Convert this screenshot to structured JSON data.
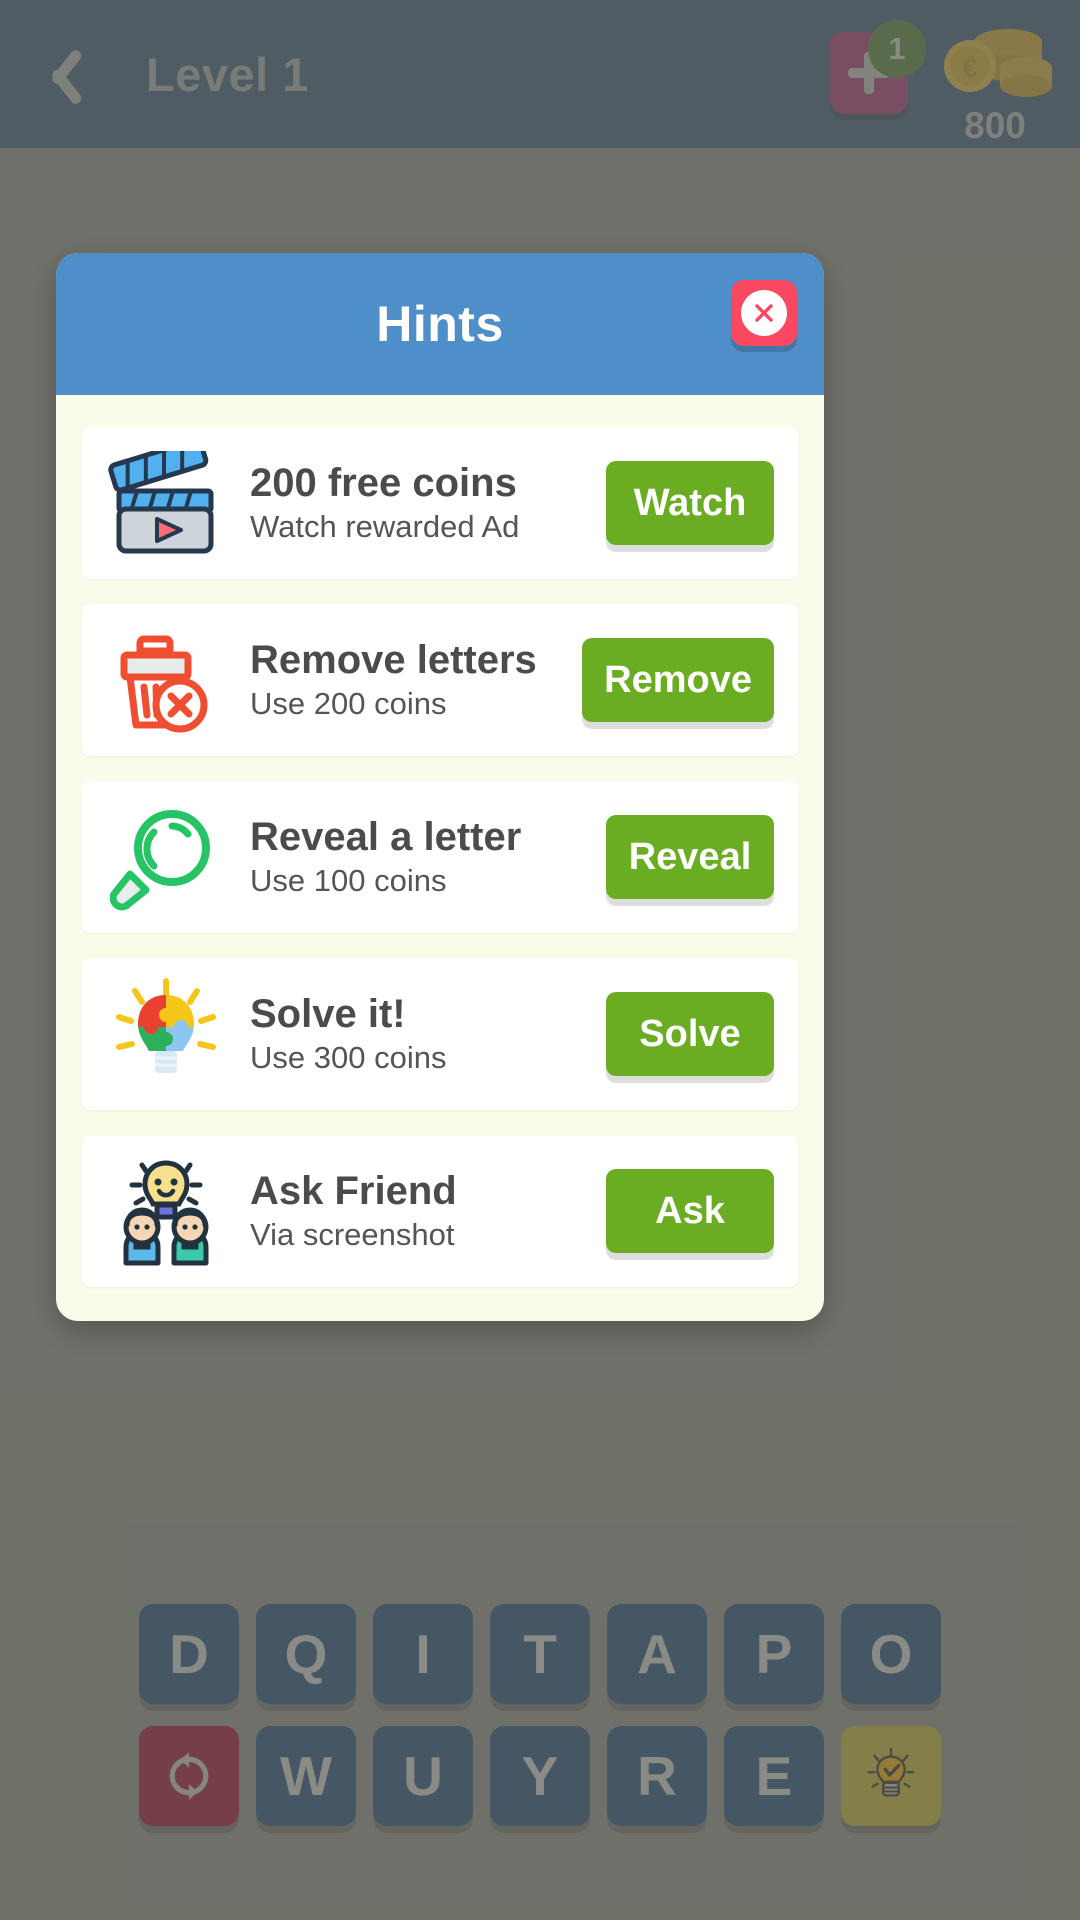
{
  "header": {
    "back_icon": "chevron-left-icon",
    "title": "Level 1",
    "add_button_icon": "plus-icon",
    "add_badge_count": "1",
    "coin_icon": "coin-stack-icon",
    "coin_amount": "800",
    "bg_color": "#2b5071"
  },
  "dialog": {
    "title": "Hints",
    "close_icon": "close-x-icon",
    "header_color": "#4f8fc9",
    "body_color": "#fbfbe9",
    "button_color": "#6bad22",
    "rows": [
      {
        "icon": "clapperboard-video-icon",
        "title": "200 free coins",
        "subtitle": "Watch rewarded Ad",
        "button": "Watch"
      },
      {
        "icon": "trash-delete-icon",
        "title": "Remove letters",
        "subtitle": "Use 200 coins",
        "button": "Remove"
      },
      {
        "icon": "magnifier-search-icon",
        "title": "Reveal a letter",
        "subtitle": "Use 100 coins",
        "button": "Reveal"
      },
      {
        "icon": "puzzle-lightbulb-icon",
        "title": "Solve it!",
        "subtitle": "Use 300 coins",
        "button": "Solve"
      },
      {
        "icon": "friends-lightbulb-icon",
        "title": "Ask Friend",
        "subtitle": "Via screenshot",
        "button": "Ask"
      }
    ]
  },
  "keyboard": {
    "row1": [
      "D",
      "Q",
      "I",
      "T",
      "A",
      "P",
      "O"
    ],
    "row2_letters": [
      "W",
      "U",
      "Y",
      "R",
      "E"
    ],
    "shuffle_icon": "shuffle-refresh-icon",
    "hint_icon": "lightbulb-hint-icon",
    "key_color": "#2d5578",
    "shuffle_color": "#9a2038",
    "hint_color": "#b8ae3c"
  }
}
